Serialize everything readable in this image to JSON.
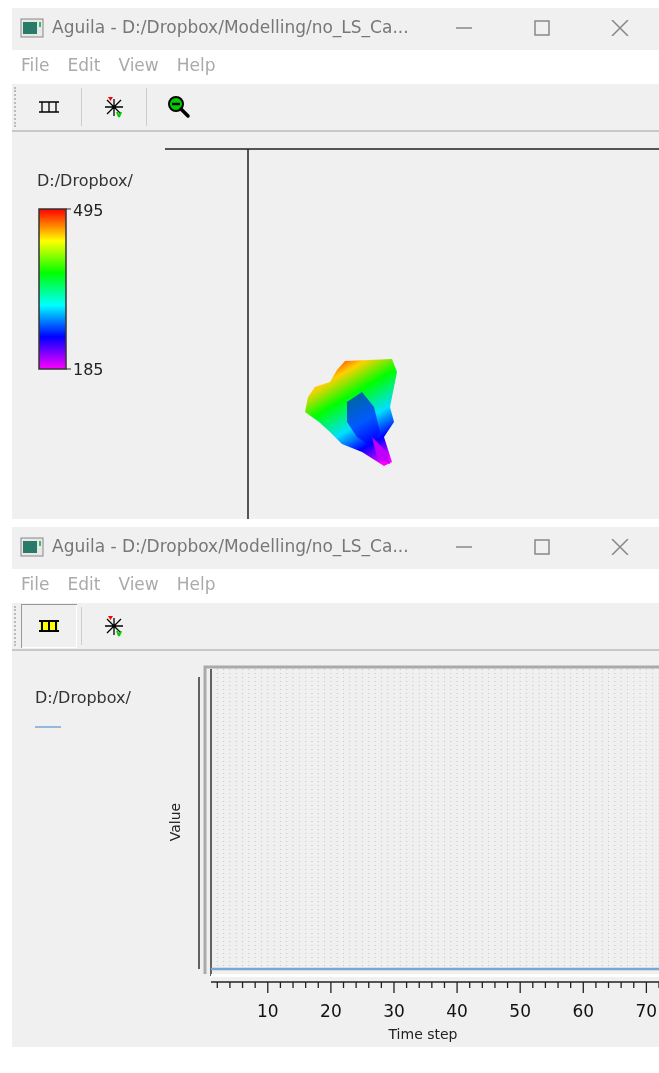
{
  "windows": [
    {
      "title": "Aguila - D:/Dropbox/Modelling/no_LS_Ca...",
      "menu": [
        "File",
        "Edit",
        "View",
        "Help"
      ],
      "toolbar": [
        {
          "kind": "legend",
          "on": false
        },
        {
          "kind": "cursor",
          "on": false
        },
        {
          "kind": "zoom",
          "on": false
        }
      ],
      "view": {
        "kind": "map",
        "legend_title": "D:/Dropbox/",
        "colorbar_max": "495",
        "colorbar_min": "185"
      }
    },
    {
      "title": "Aguila - D:/Dropbox/Modelling/no_LS_Ca...",
      "menu": [
        "File",
        "Edit",
        "View",
        "Help"
      ],
      "toolbar": [
        {
          "kind": "legend",
          "on": true
        },
        {
          "kind": "cursor",
          "on": false
        }
      ],
      "view": {
        "kind": "graph",
        "legend_title": "D:/Dropbox/",
        "xlabel": "Time step",
        "ylabel": "Value",
        "x_tick_labels": [
          "10",
          "20",
          "30",
          "40",
          "50",
          "60",
          "70"
        ]
      }
    }
  ]
}
